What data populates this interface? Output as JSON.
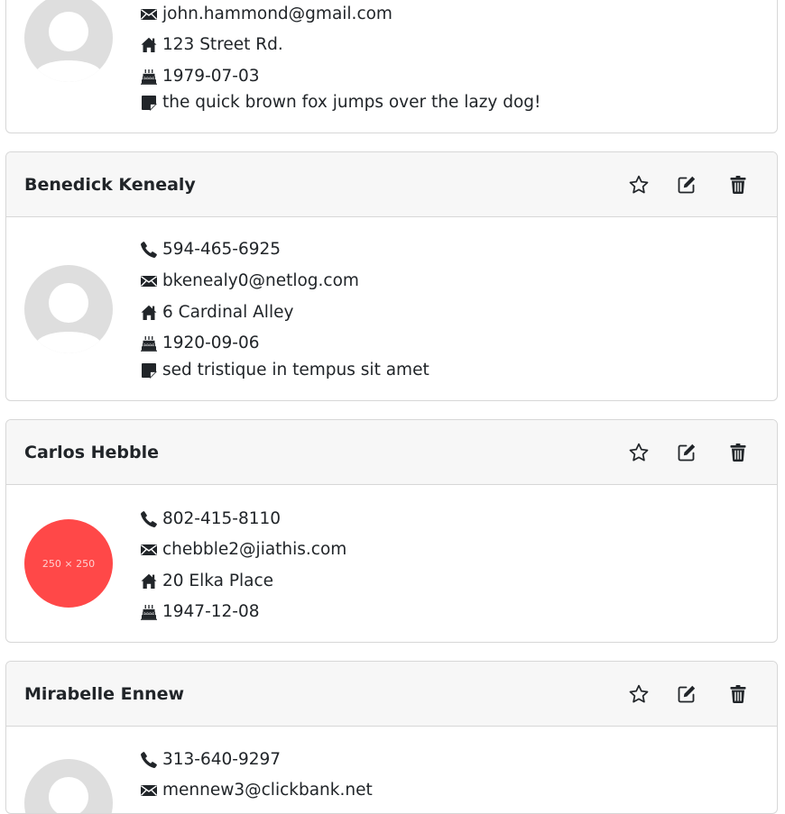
{
  "contacts": [
    {
      "name": "",
      "phone": "",
      "email": "john.hammond@gmail.com",
      "address": "123 Street Rd.",
      "birthday": "1979-07-03",
      "note": "the quick brown fox jumps over the lazy dog!",
      "avatar": "default-avatar"
    },
    {
      "name": "Benedick Kenealy",
      "phone": "594-465-6925",
      "email": "bkenealy0@netlog.com",
      "address": "6 Cardinal Alley",
      "birthday": "1920-09-06",
      "note": "sed tristique in tempus sit amet",
      "avatar": "default-avatar"
    },
    {
      "name": "Carlos Hebble",
      "phone": "802-415-8110",
      "email": "chebble2@jiathis.com",
      "address": "20 Elka Place",
      "birthday": "1947-12-08",
      "avatar": "placeholder-image",
      "avatar_text": "250 × 250",
      "avatar_color": "#ff4848"
    },
    {
      "name": "Mirabelle Ennew",
      "phone": "313-640-9297",
      "email": "mennew3@clickbank.net",
      "avatar": "default-avatar"
    }
  ],
  "icons": {
    "phone": "phone-icon",
    "email": "envelope-icon",
    "address": "house-icon",
    "birthday": "cake-icon",
    "note": "sticky-note-icon",
    "favorite": "star-icon",
    "edit": "pencil-square-icon",
    "delete": "trash-icon"
  },
  "colors": {
    "header_bg": "#f7f7f7",
    "border": "#d7d7d7",
    "text": "#212529",
    "avatar_gray": "#dedede",
    "placeholder_red": "#ff4848"
  }
}
